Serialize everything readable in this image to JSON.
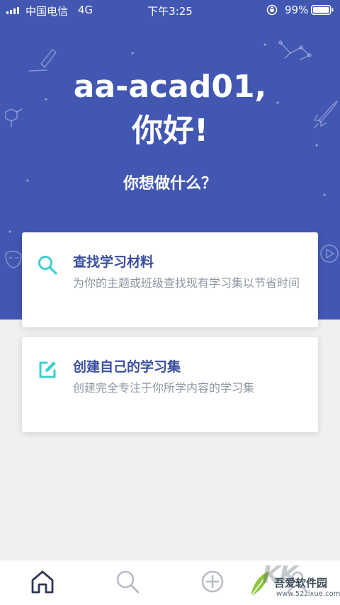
{
  "status_bar": {
    "carrier": "中国电信",
    "network": "4G",
    "time": "下午3:25",
    "battery": "99%"
  },
  "hero": {
    "username_line": "aa-acad01,",
    "hello_line": "你好!",
    "question": "你想做什么？"
  },
  "cards": {
    "find": {
      "icon": "search-icon",
      "title": "查找学习材料",
      "description": "为你的主题或班级查找现有学习集以节省时间"
    },
    "create": {
      "icon": "edit-icon",
      "title": "创建自己的学习集",
      "description": "创建完全专注于你所学内容的学习集"
    }
  },
  "tab_bar": {
    "tabs": [
      "home-icon",
      "search-icon",
      "add-icon",
      "profile-icon"
    ],
    "active": "home-icon"
  },
  "watermark": {
    "logo": "KK",
    "name": "吾爱软件园",
    "url": "www.52zixue.com"
  },
  "colors": {
    "hero_bg": "#4257b2",
    "accent_teal": "#3ccfcf",
    "title_blue": "#3b4fa0",
    "desc_gray": "#8e95a3"
  }
}
